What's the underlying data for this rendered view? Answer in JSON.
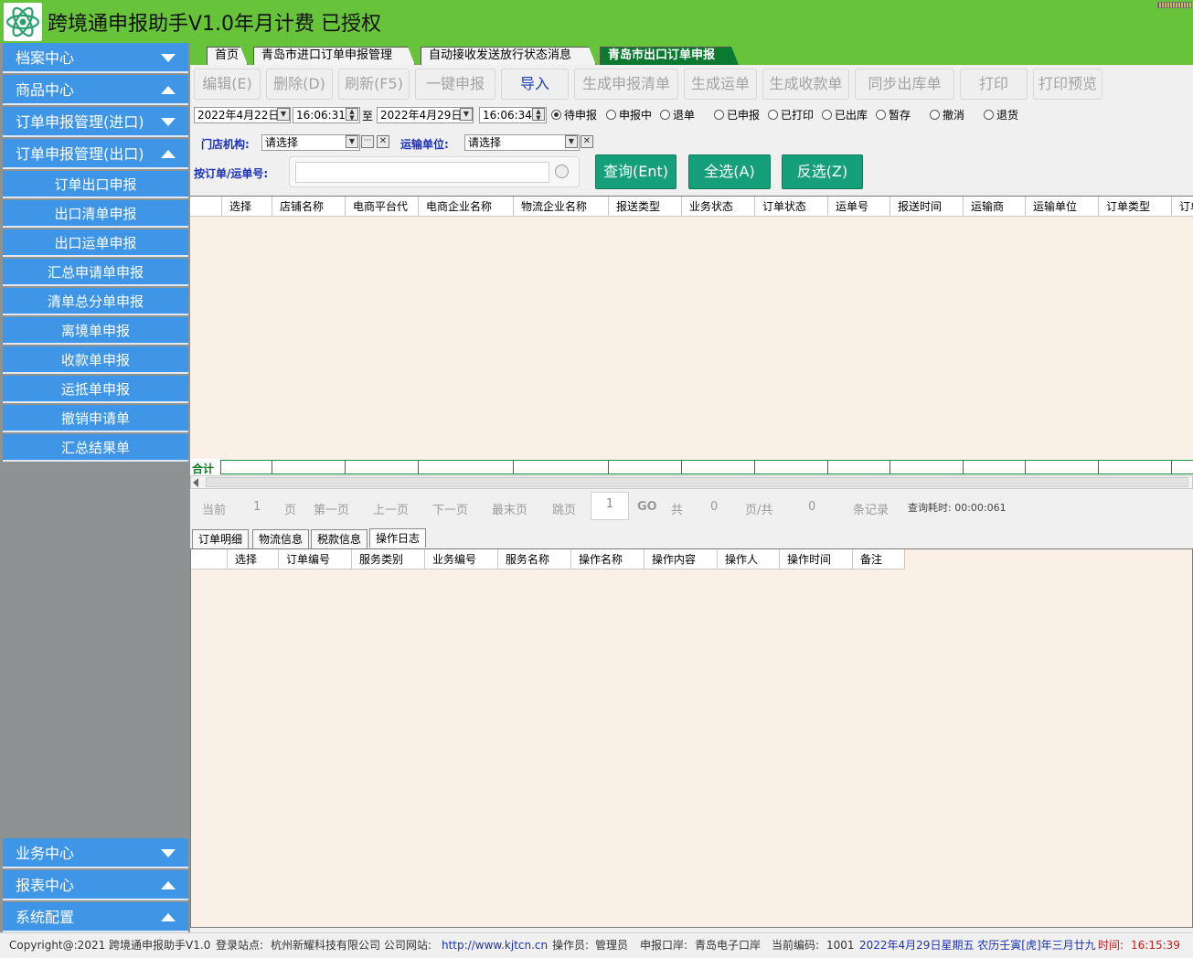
{
  "app": {
    "title": "跨境通申报助手V1.0年月计费 已授权"
  },
  "sidebar": {
    "top": [
      {
        "label": "档案中心",
        "arrow": "down"
      },
      {
        "label": "商品中心",
        "arrow": "up"
      },
      {
        "label": "订单申报管理(进口)",
        "arrow": "down"
      },
      {
        "label": "订单申报管理(出口)",
        "arrow": "up"
      }
    ],
    "sub": [
      "订单出口申报",
      "出口清单申报",
      "出口运单申报",
      "汇总申请单申报",
      "清单总分单申报",
      "离境单申报",
      "收款单申报",
      "运抵单申报",
      "撤销申请单",
      "汇总结果单"
    ],
    "bottom": [
      {
        "label": "业务中心",
        "arrow": "down"
      },
      {
        "label": "报表中心",
        "arrow": "up"
      },
      {
        "label": "系统配置",
        "arrow": "up"
      }
    ]
  },
  "tabs": [
    "首页",
    "青岛市进口订单申报管理",
    "自动接收发送放行状态消息",
    "青岛市出口订单申报"
  ],
  "toolbar": [
    "编辑(E)",
    "删除(D)",
    "刷新(F5)",
    "一键申报",
    "导入",
    "生成申报清单",
    "生成运单",
    "生成收款单",
    "同步出库单",
    "打印",
    "打印预览"
  ],
  "filter": {
    "date_from": "2022年4月22日",
    "time_from": "16:06:31",
    "to_label": "至",
    "date_to": "2022年4月29日",
    "time_to": "16:06:34",
    "statuses": [
      "待申报",
      "申报中",
      "退单",
      "已申报",
      "已打印",
      "已出库",
      "暂存",
      "撤消",
      "退货"
    ],
    "selected_status": "待申报",
    "store_label": "门店机构:",
    "store_value": "请选择",
    "carrier_label": "运输单位:",
    "carrier_value": "请选择",
    "search_label": "按订单/运单号:",
    "search_value": "",
    "query_button": "查询(Ent)",
    "select_all_button": "全选(A)",
    "invert_button": "反选(Z)"
  },
  "grid_main": {
    "columns": [
      "选择",
      "店铺名称",
      "电商平台代",
      "电商企业名称",
      "物流企业名称",
      "报送类型",
      "业务状态",
      "订单状态",
      "运单号",
      "报送时间",
      "运输商",
      "运输单位",
      "订单类型",
      "订单"
    ],
    "total_label": "合计"
  },
  "pager": {
    "current": "当前",
    "current_val": "1",
    "page": "页",
    "first": "第一页",
    "prev": "上一页",
    "next": "下一页",
    "last": "最末页",
    "jump": "跳页",
    "jump_input": "1",
    "go": "GO",
    "total_pages_label": "共",
    "total_pages": "0",
    "pages_of": "页/共",
    "records": "0",
    "records_label": "条记录",
    "query_time": "查询耗时: 00:00:061"
  },
  "subtabs": [
    "订单明细",
    "物流信息",
    "税款信息",
    "操作日志"
  ],
  "grid_log": {
    "columns": [
      "选择",
      "订单编号",
      "服务类别",
      "业务编号",
      "服务名称",
      "操作名称",
      "操作内容",
      "操作人",
      "操作时间",
      "备注"
    ]
  },
  "status": {
    "copyright": "Copyright@:2021 跨境通申报助手V1.0",
    "site_label": "登录站点:",
    "site": "杭州新耀科技有限公司 公司网站:",
    "url": "http://www.kjtcn.cn",
    "operator_label": "操作员:",
    "operator": "管理员",
    "port_label": "申报口岸:",
    "port": "青岛电子口岸",
    "code_label": "当前编码:",
    "code": "1001",
    "date": "2022年4月29日星期五 农历壬寅[虎]年三月廿九",
    "time_label": "时间:",
    "time": "16:15:39"
  },
  "colors": {
    "titlebar": "#66c33a",
    "nav": "#3f96e6",
    "active_tab": "#0b7a30",
    "action_button": "#16a07a",
    "grid_bg": "#faf0e6",
    "url": "#1a32b8",
    "date": "#1a32b8",
    "time": "#d01818"
  }
}
